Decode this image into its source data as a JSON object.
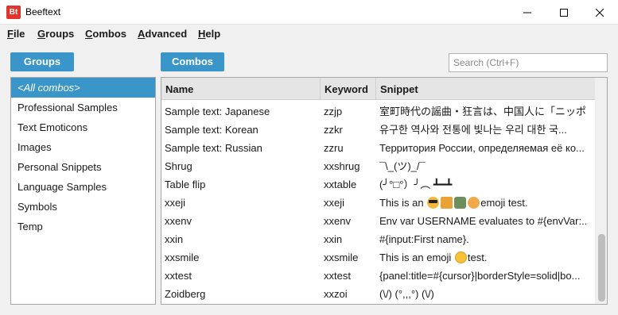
{
  "window": {
    "icon_text": "Bt",
    "title": "Beeftext"
  },
  "menu": [
    {
      "mnemonic": "F",
      "rest": "ile"
    },
    {
      "mnemonic": "G",
      "rest": "roups"
    },
    {
      "mnemonic": "C",
      "rest": "ombos"
    },
    {
      "mnemonic": "A",
      "rest": "dvanced"
    },
    {
      "mnemonic": "H",
      "rest": "elp"
    }
  ],
  "groups": {
    "heading": "Groups",
    "items": [
      "<All combos>",
      "Professional Samples",
      "Text Emoticons",
      "Images",
      "Personal Snippets",
      "Language Samples",
      "Symbols",
      "Temp"
    ],
    "selected_index": 0
  },
  "combos": {
    "heading": "Combos",
    "search_placeholder": "Search (Ctrl+F)",
    "columns": [
      "Name",
      "Keyword",
      "Snippet"
    ],
    "rows": [
      {
        "name": "Sample text: Japanese",
        "keyword": "zzjp",
        "snippet": "室町時代の謡曲・狂言は、中国人に「ニッポン」..."
      },
      {
        "name": "Sample text: Korean",
        "keyword": "zzkr",
        "snippet": "유구한 역사와 전통에 빛나는 우리 대한 국..."
      },
      {
        "name": "Sample text: Russian",
        "keyword": "zzru",
        "snippet": "Территория России, определяемая её ко..."
      },
      {
        "name": "Shrug",
        "keyword": "xxshrug",
        "snippet": "¯\\_(ツ)_/¯"
      },
      {
        "name": "Table flip",
        "keyword": "xxtable",
        "snippet": "(╯°□°）╯︵ ┻━┻"
      },
      {
        "name": "xxeji",
        "keyword": "xxeji",
        "snippet_pre": "This is an ",
        "snippet_post": "emoji test."
      },
      {
        "name": "xxenv",
        "keyword": "xxenv",
        "snippet": "Env var USERNAME evaluates to #{envVar:..."
      },
      {
        "name": "xxin",
        "keyword": "xxin",
        "snippet": "#{input:First name}."
      },
      {
        "name": "xxsmile",
        "keyword": "xxsmile",
        "snippet_pre": "This is an emoji ",
        "snippet_post": "test."
      },
      {
        "name": "xxtest",
        "keyword": "xxtest",
        "snippet": "{panel:title=#{cursor}|borderStyle=solid|bo..."
      },
      {
        "name": "Zoidberg",
        "keyword": "xxzoi",
        "snippet": "(\\/) (°,,,°) (\\/)"
      }
    ]
  },
  "colors": {
    "accent": "#3a96c8",
    "app_icon": "#e0342c"
  },
  "icons": [
    "app-logo-icon",
    "minimize-icon",
    "maximize-icon",
    "close-icon",
    "sort-up-icon",
    "emoji-sunglasses-icon",
    "emoji-gift-icon",
    "emoji-woman-icon",
    "emoji-person-icon",
    "emoji-smile-icon"
  ]
}
